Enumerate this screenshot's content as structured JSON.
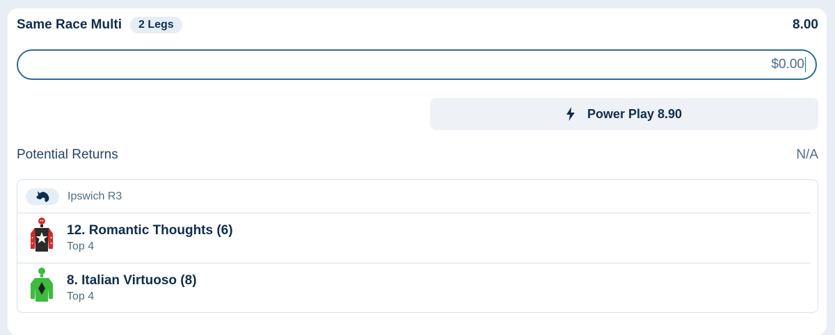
{
  "bet": {
    "title": "Same Race Multi",
    "legs_badge": "2 Legs",
    "odds": "8.00"
  },
  "stake": {
    "value": "$0.00"
  },
  "power_play": {
    "label": "Power Play 8.90",
    "icon": "lightning-bolt-icon"
  },
  "returns": {
    "label": "Potential Returns",
    "value": "N/A"
  },
  "race": {
    "icon": "horse-head-icon",
    "name": "Ipswich R3"
  },
  "legs": [
    {
      "name": "12. Romantic Thoughts (6)",
      "market": "Top 4",
      "silk_colors": {
        "body": "#2b2b2b",
        "sleeves": "#d32a2a",
        "cap": "#d32a2a",
        "emblem": "#ffffff"
      }
    },
    {
      "name": "8. Italian Virtuoso (8)",
      "market": "Top 4",
      "silk_colors": {
        "body": "#3dbb3d",
        "sleeves": "#3dbb3d",
        "cap": "#3dbb3d",
        "emblem": "#1f1f1f"
      }
    }
  ],
  "colors": {
    "accent": "#2a6a96",
    "text": "#0f2d4c",
    "muted": "#4d6c87"
  }
}
